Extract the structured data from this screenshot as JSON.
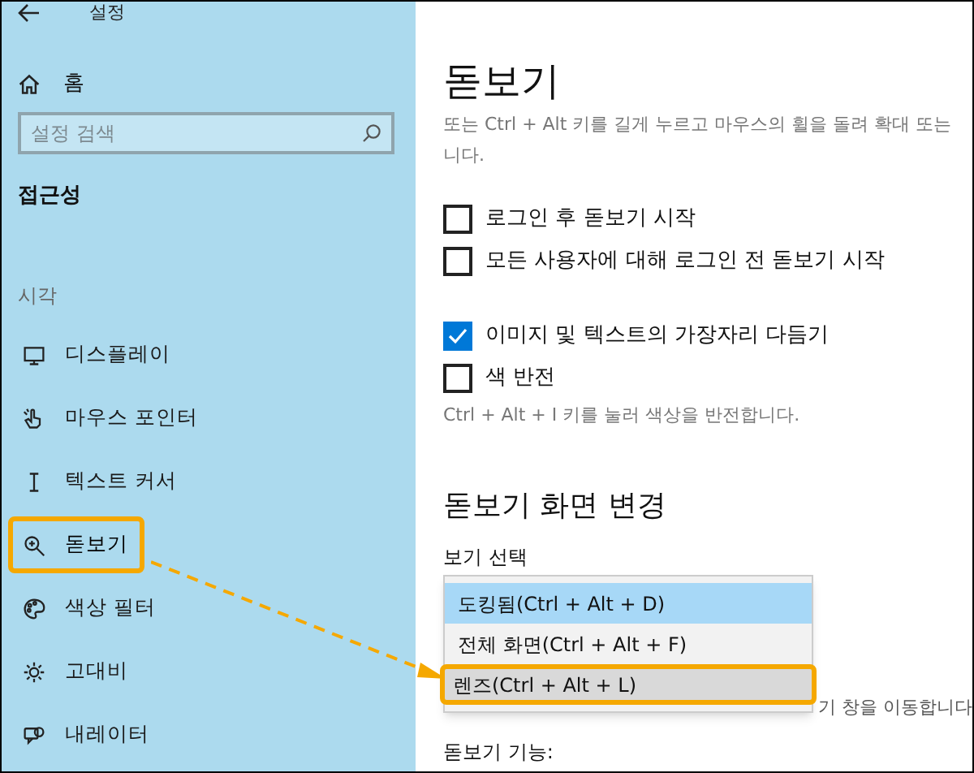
{
  "window": {
    "title": "설정"
  },
  "sidebar": {
    "home": "홈",
    "search": {
      "placeholder": "설정 검색"
    },
    "section": "접근성",
    "group": "시각",
    "items": [
      {
        "kind": "display",
        "label": "디스플레이",
        "selected": false,
        "highlighted": false
      },
      {
        "kind": "pointer",
        "label": "마우스 포인터",
        "selected": false,
        "highlighted": false
      },
      {
        "kind": "cursor",
        "label": "텍스트 커서",
        "selected": false,
        "highlighted": false
      },
      {
        "kind": "magnifier",
        "label": "돋보기",
        "selected": true,
        "highlighted": true
      },
      {
        "kind": "palette",
        "label": "색상 필터",
        "selected": false,
        "highlighted": false
      },
      {
        "kind": "contrast",
        "label": "고대비",
        "selected": false,
        "highlighted": false
      },
      {
        "kind": "narrator",
        "label": "내레이터",
        "selected": false,
        "highlighted": false
      }
    ]
  },
  "main": {
    "title": "돋보기",
    "description": [
      "또는 Ctrl + Alt 키를 길게 누르고 마우스의 휠을 돌려 확대 또는",
      "니다."
    ],
    "options": [
      {
        "label": "로그인 후 돋보기 시작",
        "checked": false
      },
      {
        "label": "모든 사용자에 대해 로그인 전 돋보기 시작",
        "checked": false
      }
    ],
    "options2": [
      {
        "label": "이미지 및 텍스트의 가장자리 다듬기",
        "checked": true
      },
      {
        "label": "색 반전",
        "checked": false
      }
    ],
    "invert_hint": "Ctrl + Alt + I 키를 눌러 색상을 반전합니다.",
    "view_heading": "돋보기 화면 변경",
    "view_label": "보기 선택",
    "view_menu": [
      {
        "label": "도킹됨(Ctrl + Alt + D)",
        "selected": true,
        "highlighted": false
      },
      {
        "label": "전체 화면(Ctrl + Alt + F)",
        "selected": false,
        "highlighted": false
      },
      {
        "label": "렌즈(Ctrl + Alt + L)",
        "selected": false,
        "highlighted": true
      }
    ],
    "lens_hint": "기 창을 이동합니다",
    "features_label": "돋보기 기능:"
  },
  "annotation_arrow": true
}
